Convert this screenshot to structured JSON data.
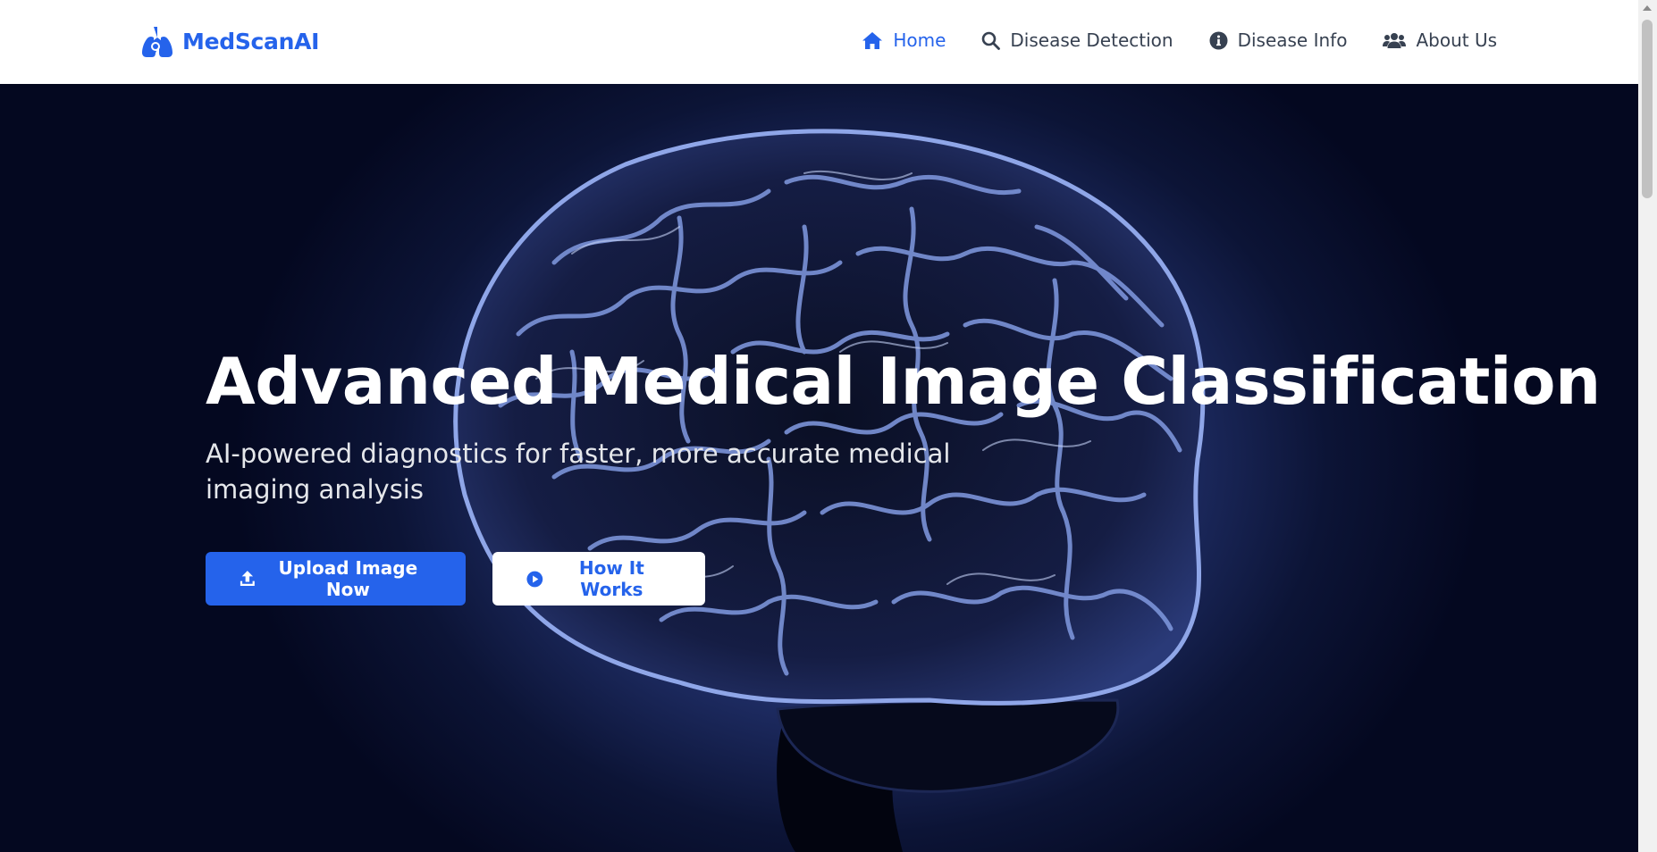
{
  "brand": {
    "name": "MedScanAI",
    "icon": "lungs-virus-icon",
    "color": "#2563eb"
  },
  "nav": {
    "items": [
      {
        "label": "Home",
        "icon": "home-icon",
        "active": true
      },
      {
        "label": "Disease Detection",
        "icon": "search-icon",
        "active": false
      },
      {
        "label": "Disease Info",
        "icon": "info-circle-icon",
        "active": false
      },
      {
        "label": "About Us",
        "icon": "users-icon",
        "active": false
      }
    ],
    "active_color": "#2563eb",
    "text_color": "#374151"
  },
  "hero": {
    "title": "Advanced Medical Image Classification",
    "subtitle": "AI-powered diagnostics for faster, more accurate medical imaging analysis",
    "background_image": "brain-illustration",
    "buttons": {
      "upload": {
        "label": "Upload Image Now",
        "icon": "upload-icon"
      },
      "how": {
        "label": "How It Works",
        "icon": "play-circle-icon"
      }
    }
  }
}
